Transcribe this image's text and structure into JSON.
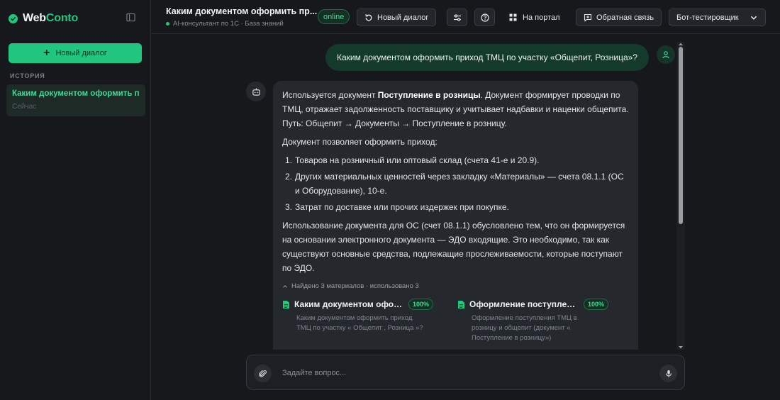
{
  "sidebar": {
    "brand_prefix": "Web",
    "brand_suffix": "Conto",
    "new_chat_label": "Новый диалог",
    "history_label": "ИСТОРИЯ",
    "history": [
      {
        "title": "Каким документом оформить приход ТМЦ по участку «Общепит, Розница»?",
        "time": "Сейчас"
      }
    ]
  },
  "header": {
    "title": "Каким документом оформить пр...",
    "subtitle": "AI-консультант по 1С · База знаний",
    "status": "online",
    "new_dialog_label": "Новый диалог",
    "portal_label": "На портал",
    "feedback_label": "Обратная связь",
    "bot_select_label": "Бот-тестировщик"
  },
  "chat": {
    "user_message": "Каким документом оформить приход ТМЦ по участку «Общепит, Розница»?",
    "bot": {
      "p1_pre": "Используется документ ",
      "p1_bold": "Поступление в розницы",
      "p1_post": ". Документ формирует проводки по ТМЦ, отражает задолженность поставщику и учитывает надбавки и наценки общепита. Путь: Общепит → Документы → Поступление в розницу.",
      "p2": "Документ позволяет оформить приход:",
      "list": [
        {
          "num": "1.",
          "text": "Товаров на розничный или оптовый склад (счета 41-е и 20.9)."
        },
        {
          "num": "2.",
          "text": "Других материальных ценностей через закладку «Материалы» — счета 08.1.1 (ОС и Оборудование), 10-е."
        },
        {
          "num": "3.",
          "text": "Затрат по доставке или прочих издержек при покупке."
        }
      ],
      "p3": "Использование документа для ОС (счет 08.1.1) обусловлено тем, что он формируется на основании электронного документа — ЭДО входящие. Это необходимо, так как существуют основные средства, подлежащие прослеживаемости, которые поступают по ЭДО.",
      "sources_toggle": "Найдено 3 материалов · использовано 3",
      "sources": [
        {
          "title": "Каким документом оформить приход ТМЦ",
          "badge": "100%",
          "snippet": "Каким документом оформить приход ТМЦ по участку « Общепит , Розница »?"
        },
        {
          "title": "Оформление поступления ТМЦ",
          "badge": "100%",
          "snippet": "Оформление поступления ТМЦ в розницу и общепит (документ « Поступление в розницу»)"
        }
      ]
    }
  },
  "composer": {
    "placeholder": "Задайте вопрос..."
  },
  "colors": {
    "accent": "#22c77f",
    "background": "#16181b",
    "bot_bubble": "#25292e",
    "user_bubble": "#143a2b"
  },
  "icons": [
    "check-icon",
    "sidebar-toggle-icon",
    "plus-icon",
    "refresh-icon",
    "settings-sliders-icon",
    "help-icon",
    "grid-icon",
    "feedback-icon",
    "chevron-down-icon",
    "user-icon",
    "bot-icon",
    "chevron-up-icon",
    "document-icon",
    "paperclip-icon",
    "microphone-icon"
  ]
}
